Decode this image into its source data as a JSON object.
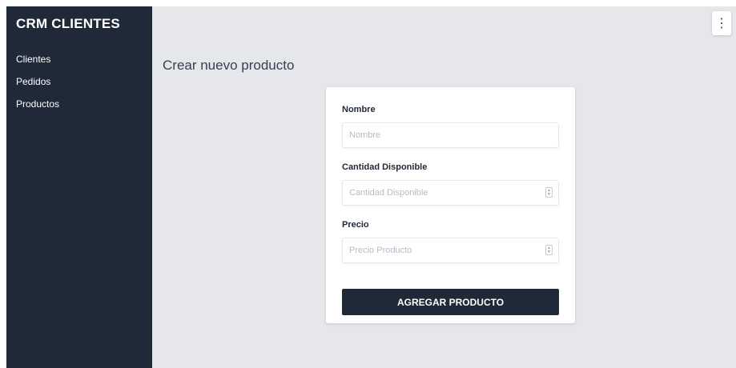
{
  "sidebar": {
    "brand": "CRM CLIENTES",
    "items": [
      {
        "label": "Clientes"
      },
      {
        "label": "Pedidos"
      },
      {
        "label": "Productos"
      }
    ]
  },
  "header": {
    "menu_icon": "kebab-menu-icon",
    "menu_glyph": "⋮"
  },
  "main": {
    "title": "Crear nuevo producto"
  },
  "form": {
    "nombre": {
      "label": "Nombre",
      "placeholder": "Nombre",
      "value": ""
    },
    "cantidad": {
      "label": "Cantidad Disponible",
      "placeholder": "Cantidad Disponible",
      "value": ""
    },
    "precio": {
      "label": "Precio",
      "placeholder": "Precio Producto",
      "value": ""
    },
    "submit_label": "AGREGAR PRODUCTO"
  },
  "colors": {
    "sidebar_bg": "#1f2937",
    "content_bg": "#e5e7eb",
    "button_bg": "#1f2937"
  }
}
